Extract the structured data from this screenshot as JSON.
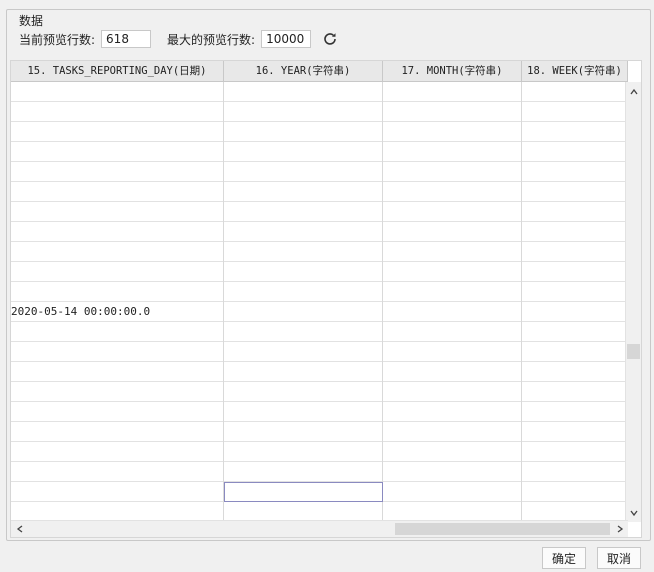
{
  "group_title": "数据",
  "preview": {
    "current_label": "当前预览行数:",
    "current_value": "618",
    "max_label": "最大的预览行数:",
    "max_value": "10000",
    "refresh_icon": "refresh-icon"
  },
  "grid": {
    "columns": [
      "15. TASKS_REPORTING_DAY(日期)",
      "16. YEAR(字符串)",
      "17. MONTH(字符串)",
      "18. WEEK(字符串)"
    ],
    "visible_value": "2020-05-14 00:00:00.0"
  },
  "buttons": {
    "ok": "确定",
    "cancel": "取消"
  }
}
